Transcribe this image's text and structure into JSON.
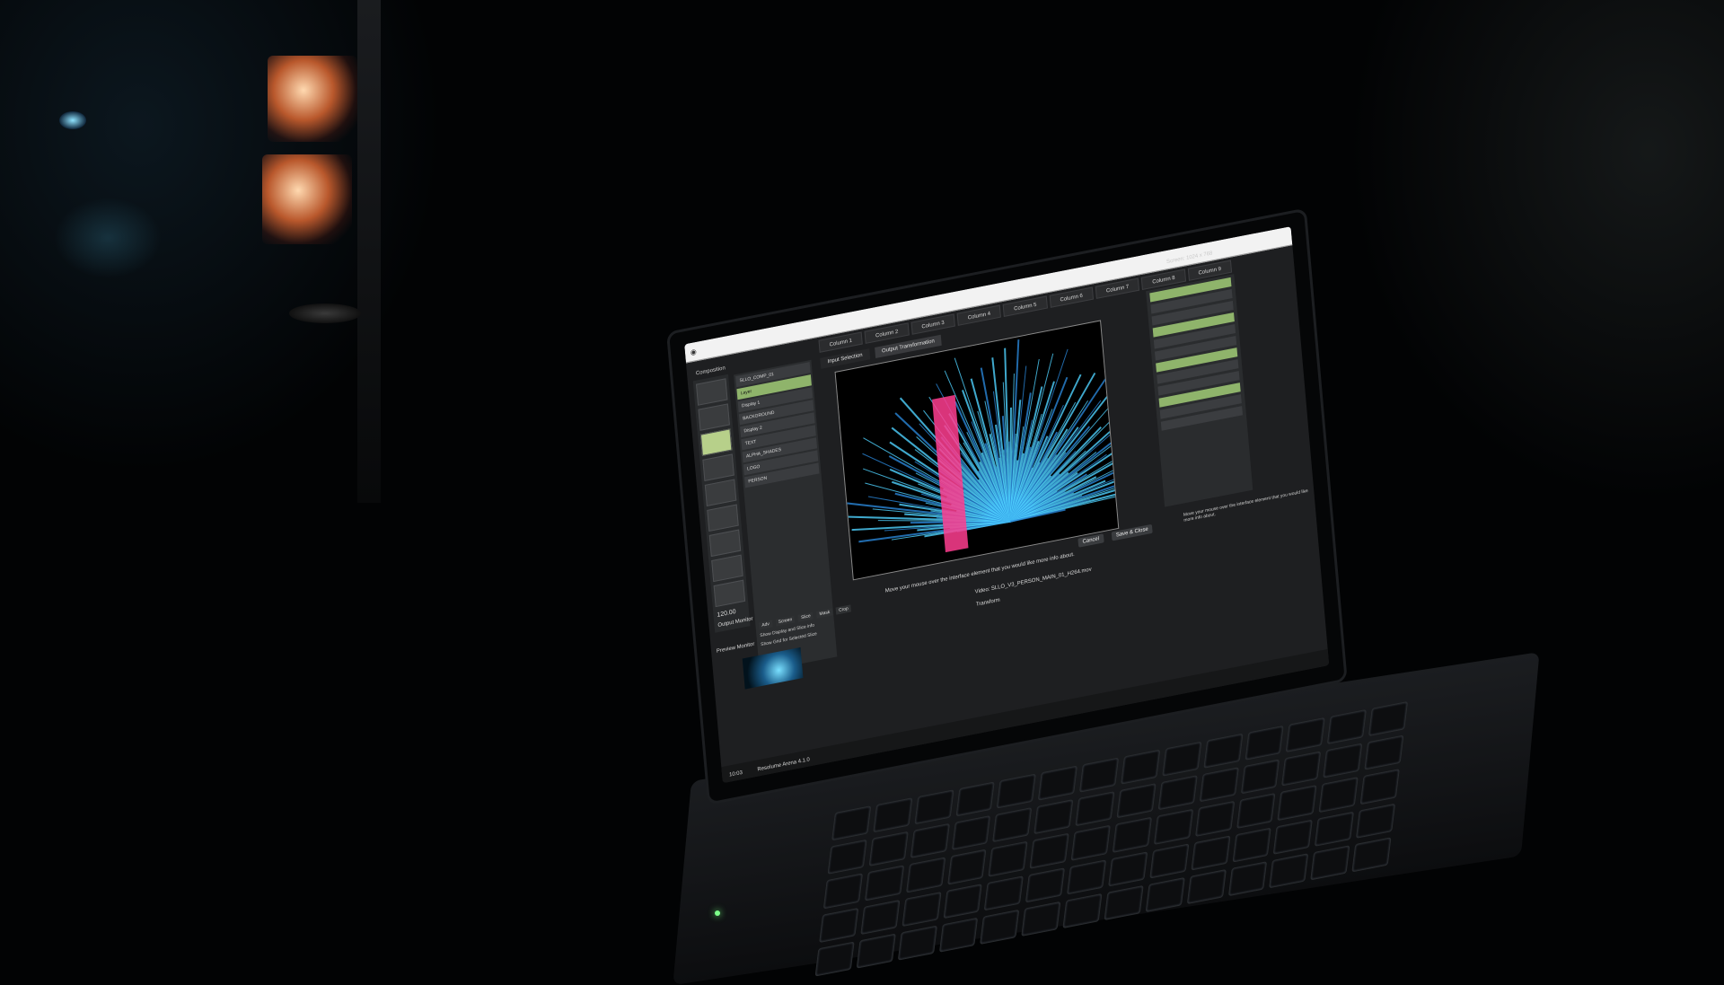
{
  "scene": {
    "description_tags": [
      "dark-room",
      "laptop",
      "vj-software"
    ]
  },
  "app": {
    "menubar_close": "◉",
    "columns": [
      "Column 1",
      "Column 2",
      "Column 3",
      "Column 4",
      "Column 5",
      "Column 6",
      "Column 7",
      "Column 8",
      "Column 9"
    ],
    "screen_res": "Screen: 1024 x 768",
    "composition_label": "Composition",
    "tabs": [
      "Input Selection",
      "Output Transformation"
    ],
    "layer_items": [
      "SLLO_COMP_01",
      "Layer",
      "Display 1",
      "BACKGROUND",
      "Display 2",
      "TEXT",
      "ALPHA_SHADES",
      "LOGO",
      "PERSON"
    ],
    "status_message": "Move your mouse over the interface element that you would like more info about.",
    "info_message": "Move your mouse over the interface element that you would like more info about.",
    "file_name": "Video: SLLO_V3_PERSON_MAIN_01_H264.mov",
    "transform_label": "Transform",
    "preview_label": "Preview Monitor",
    "output_label": "Output Monitor",
    "bpm": "120.00",
    "check1": "Show Display and Slice info",
    "check2": "Show Grid for Selected Slice",
    "tiny_tabs": [
      "Adv",
      "Screen",
      "Slice",
      "Mask",
      "Crop"
    ],
    "cancel_btn": "Cancel",
    "save_btn": "Save & Close",
    "bottom_text": "Resolume Arena 4.1.0",
    "time": "10:03"
  },
  "colors": {
    "accent": "#8fb46b",
    "viewer_rays_1": "#4fd2ff",
    "viewer_rays_2": "#2a86d8",
    "figure": "#ff3d8f"
  }
}
